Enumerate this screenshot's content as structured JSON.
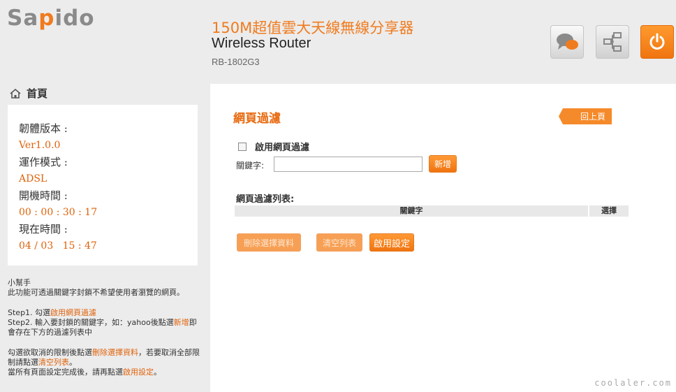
{
  "brand": {
    "logo_prefix": "Sa",
    "logo_o": "p",
    "logo_suffix": "ido",
    "accent": "#f07b1e"
  },
  "header": {
    "title_cn": "150M超值雲大天線無線分享器",
    "title_en": "Wireless Router",
    "model": "RB-1802G3",
    "buttons": [
      {
        "icon": "chat-icon"
      },
      {
        "icon": "network-icon"
      },
      {
        "icon": "power-icon"
      }
    ]
  },
  "sidebar": {
    "home_label": "首頁",
    "info": {
      "fw_label": "韌體版本 :",
      "fw_value": "Ver1.0.0",
      "mode_label": "運作模式 :",
      "mode_value": "ADSL",
      "uptime_label": "開機時間 :",
      "uptime_value": "00 : 00 : 30 : 17",
      "time_label": "現在時間 :",
      "time_value": "04 / 03   15 : 47"
    },
    "help": {
      "title": "小幫手",
      "intro": "此功能可透過關鍵字封鎖不希望使用者瀏覽的網頁。",
      "step1_pre": "Step1. 勾選",
      "step1_hl": "啟用網頁過濾",
      "step2_pre": "Step2. 輸入要封鎖的關鍵字，如：yahoo後點選",
      "step2_hl": "新增",
      "step2_post": "即會存在下方的過濾列表中",
      "p3_pre": "勾選欲取消的限制後點選",
      "p3_hl": "刪除選擇資料",
      "p3_mid": "，若要取消全部限制請點選",
      "p3_hl2": "清空列表",
      "p3_post": "。",
      "p4_pre": "當所有頁面設定完成後，請再點選",
      "p4_hl": "啟用設定",
      "p4_post": "。"
    }
  },
  "main": {
    "title": "網頁過濾",
    "back_label": "回上頁",
    "enable_label": "啟用網頁過濾",
    "keyword_label": "關鍵字:",
    "keyword_value": "",
    "add_label": "新增",
    "list_title": "網頁過濾列表:",
    "col_keyword": "關鍵字",
    "col_select": "選擇",
    "delete_label": "刪除選擇資料",
    "clear_label": "清空列表",
    "apply_label": "啟用設定"
  },
  "watermark": "coolaler.com"
}
